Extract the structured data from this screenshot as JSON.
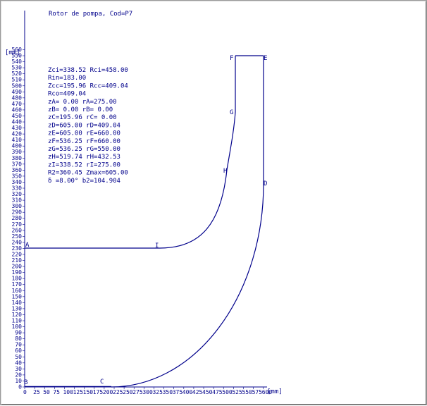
{
  "title": "Rotor de pompa, Cod=P7",
  "axis": {
    "y_unit": "[mm]",
    "x_unit": "[mm]",
    "y_range": [
      0,
      560
    ],
    "y_step": 10,
    "x_range": [
      0,
      605
    ],
    "x_ticks": [
      "0",
      "25",
      "50",
      "75",
      "100",
      "125",
      "150",
      "175",
      "200",
      "225",
      "250",
      "275",
      "300",
      "325",
      "350",
      "375",
      "400",
      "425",
      "450",
      "475",
      "500",
      "525",
      "550",
      "575",
      "600"
    ]
  },
  "parameters": [
    "Zci=338.52 Rci=458.00",
    "Rin=183.00",
    "Zcc=195.96 Rcc=409.04",
    "Rco=409.04",
    "zA= 0.00  rA=275.00",
    "zB= 0.00  rB= 0.00",
    "zC=195.96 rC= 0.00",
    "zD=605.00 rD=409.04",
    "zE=605.00 rE=660.00",
    "zF=536.25 rF=660.00",
    "zG=536.25 rG=550.00",
    "zH=519.74 rH=432.53",
    "zI=338.52 rI=275.00",
    "R2=360.45 Zmax=605.00",
    "δ =8.00°  b2=104.904"
  ],
  "points": [
    {
      "label": "A",
      "z": 0,
      "r": 275
    },
    {
      "label": "B",
      "z": 0,
      "r": 0
    },
    {
      "label": "C",
      "z": 195.96,
      "r": 0
    },
    {
      "label": "D",
      "z": 605,
      "r": 409.04
    },
    {
      "label": "E",
      "z": 605,
      "r": 660
    },
    {
      "label": "F",
      "z": 536.25,
      "r": 660
    },
    {
      "label": "G",
      "z": 536.25,
      "r": 550
    },
    {
      "label": "H",
      "z": 519.74,
      "r": 432.53
    },
    {
      "label": "I",
      "z": 338.52,
      "r": 275
    }
  ],
  "colors": {
    "line": "#00008b",
    "frame": "#9a9a9a",
    "background": "#ffffff"
  }
}
